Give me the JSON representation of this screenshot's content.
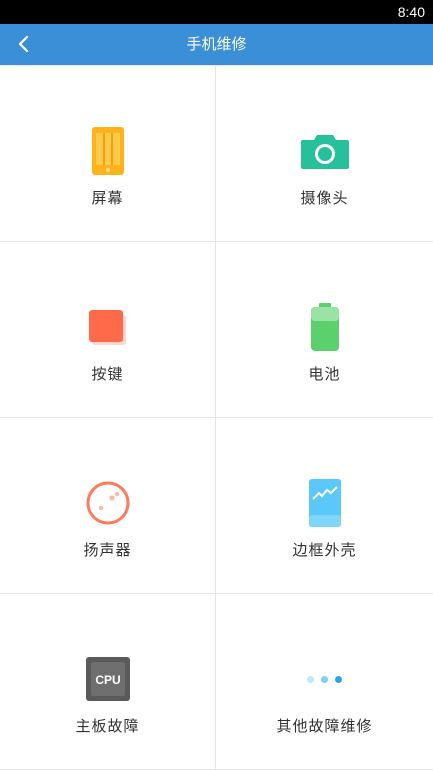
{
  "status_bar": {
    "time": "8:40"
  },
  "app_bar": {
    "title": "手机维修",
    "back_icon": "chevron-left-icon"
  },
  "colors": {
    "app_bar": "#3a8fd6",
    "screen": "#ffb31a",
    "camera": "#26c09a",
    "button": "#ff6b4a",
    "battery": "#5dd06e",
    "speaker": "#ff7b5c",
    "frame": "#5ac8fa",
    "chip": "#5a5a5a",
    "dots_light": "#bfe6fb",
    "dots_mid": "#7fd0f7",
    "dots_dark": "#2aa4e8"
  },
  "grid": {
    "items": [
      {
        "label": "屏幕",
        "icon": "phone-screen-icon"
      },
      {
        "label": "摄像头",
        "icon": "camera-icon"
      },
      {
        "label": "按键",
        "icon": "button-key-icon"
      },
      {
        "label": "电池",
        "icon": "battery-icon"
      },
      {
        "label": "扬声器",
        "icon": "speaker-icon"
      },
      {
        "label": "边框外壳",
        "icon": "phone-frame-icon"
      },
      {
        "label": "主板故障",
        "icon": "cpu-chip-icon",
        "chip_text": "CPU"
      },
      {
        "label": "其他故障维修",
        "icon": "more-dots-icon"
      }
    ]
  }
}
